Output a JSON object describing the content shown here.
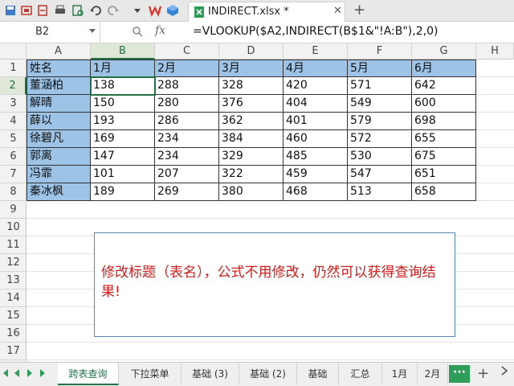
{
  "toolbar": {
    "icons": [
      "save-icon",
      "print-preview-icon",
      "export-icon",
      "print-icon",
      "preview-icon",
      "undo-icon",
      "redo-icon",
      "dropdown-icon",
      "wps-logo",
      "cube-icon",
      "excel-file-icon"
    ]
  },
  "tab": {
    "title": "INDIRECT.xlsx *",
    "close": "✕",
    "add": "+"
  },
  "formula_bar": {
    "cell_ref": "B2",
    "fx": "fx",
    "formula": "=VLOOKUP($A2,INDIRECT(B$1&\"!A:B\"),2,0)"
  },
  "columns": [
    "A",
    "B",
    "C",
    "D",
    "E",
    "F",
    "G",
    "H"
  ],
  "rows": [
    "1",
    "2",
    "3",
    "4",
    "5",
    "6",
    "7",
    "8",
    "9",
    "10",
    "11",
    "12",
    "13",
    "14",
    "15",
    "16",
    "17"
  ],
  "table": {
    "header": [
      "姓名",
      "1月",
      "2月",
      "3月",
      "4月",
      "5月",
      "6月"
    ],
    "rows": [
      [
        "董涵柏",
        "138",
        "288",
        "328",
        "420",
        "571",
        "642"
      ],
      [
        "解晴",
        "150",
        "280",
        "376",
        "404",
        "549",
        "600"
      ],
      [
        "薛以",
        "193",
        "286",
        "362",
        "401",
        "579",
        "698"
      ],
      [
        "徐碧凡",
        "169",
        "234",
        "384",
        "460",
        "572",
        "655"
      ],
      [
        "郭离",
        "147",
        "234",
        "329",
        "485",
        "530",
        "675"
      ],
      [
        "冯霏",
        "101",
        "207",
        "322",
        "459",
        "547",
        "651"
      ],
      [
        "秦冰枫",
        "189",
        "269",
        "380",
        "468",
        "513",
        "658"
      ]
    ]
  },
  "textbox": {
    "text": "修改标题（表名），公式不用修改，仍然可以获得查询结果!"
  },
  "sheets": {
    "active": "跨表查询",
    "tabs": [
      "跨表查询",
      "下拉菜单",
      "基础 (3)",
      "基础 (2)",
      "基础",
      "汇总",
      "1月",
      "2月"
    ],
    "more": "···",
    "add": "+"
  },
  "colors": {
    "header_fill": "#9dc3e6",
    "accent": "#217346",
    "text_red": "#d41c1c"
  }
}
